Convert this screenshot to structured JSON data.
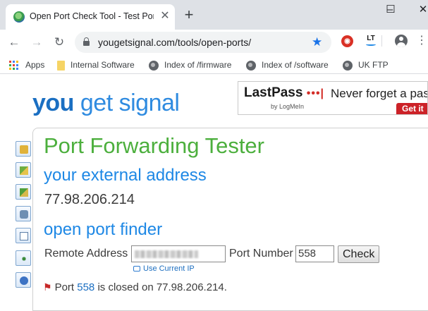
{
  "browser": {
    "tab_title": "Open Port Check Tool - Test Port",
    "tab_close": "✕",
    "new_tab": "+",
    "window": {
      "minimize": "–",
      "maximize": "☐",
      "close": "✕"
    },
    "nav": {
      "back": "←",
      "forward": "→",
      "reload": "↻"
    },
    "url": "yougetsignal.com/tools/open-ports/",
    "star": "★",
    "menu": "⋮",
    "extensions": {
      "red_label": "◉",
      "lt_label": "LT"
    }
  },
  "bookmarks": [
    {
      "label": "Apps",
      "icon": "apps-grid-icon"
    },
    {
      "label": "Internal Software",
      "icon": "folder-icon"
    },
    {
      "label": "Index of /firmware",
      "icon": "globe-icon"
    },
    {
      "label": "Index of /software",
      "icon": "globe-icon"
    },
    {
      "label": "UK FTP",
      "icon": "globe-icon"
    }
  ],
  "site": {
    "logo_you": "you",
    "logo_rest": " get signal",
    "ad": {
      "brand": "LastPass",
      "dots": "•••|",
      "by": "by LogMeIn",
      "tagline": "Never forget a pass",
      "cta": "Get it"
    }
  },
  "tool": {
    "title": "Port Forwarding Tester",
    "external_heading": "your external address",
    "external_ip": "77.98.206.214",
    "finder_heading": "open port finder",
    "remote_label": "Remote Address",
    "port_label": "Port Number",
    "port_value": "558",
    "check_button": "Check",
    "use_current_ip": "Use Current IP",
    "result": {
      "prefix": "Port ",
      "port": "558",
      "suffix": " is closed on 77.98.206.214."
    }
  },
  "colors": {
    "title_green": "#4caf3d",
    "heading_blue": "#1e88e5",
    "logo_blue": "#1b6fc2",
    "closed_flag": "#c62828"
  }
}
